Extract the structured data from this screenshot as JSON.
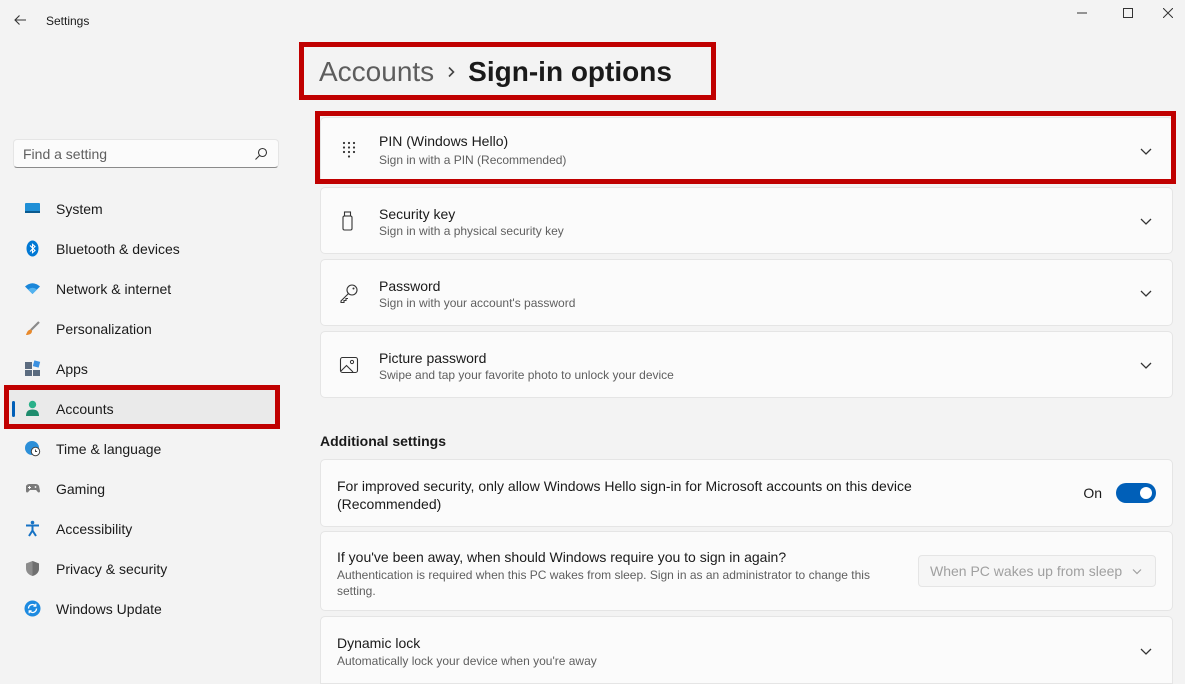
{
  "window": {
    "title": "Settings",
    "back_icon": "back-arrow-icon",
    "controls": [
      "minimize-icon",
      "maximize-icon",
      "close-icon"
    ]
  },
  "search": {
    "placeholder": "Find a setting",
    "icon": "search-icon"
  },
  "sidebar": {
    "items": [
      {
        "label": "System",
        "icon": "system-icon",
        "active": false
      },
      {
        "label": "Bluetooth & devices",
        "icon": "bluetooth-icon",
        "active": false
      },
      {
        "label": "Network & internet",
        "icon": "wifi-icon",
        "active": false
      },
      {
        "label": "Personalization",
        "icon": "brush-icon",
        "active": false
      },
      {
        "label": "Apps",
        "icon": "apps-icon",
        "active": false
      },
      {
        "label": "Accounts",
        "icon": "person-icon",
        "active": true
      },
      {
        "label": "Time & language",
        "icon": "globe-clock-icon",
        "active": false
      },
      {
        "label": "Gaming",
        "icon": "gamepad-icon",
        "active": false
      },
      {
        "label": "Accessibility",
        "icon": "accessibility-icon",
        "active": false
      },
      {
        "label": "Privacy & security",
        "icon": "shield-icon",
        "active": false
      },
      {
        "label": "Windows Update",
        "icon": "update-icon",
        "active": false
      }
    ]
  },
  "breadcrumb": {
    "parent": "Accounts",
    "separator_icon": "chevron-right-icon",
    "current": "Sign-in options"
  },
  "signin_options": [
    {
      "title": "PIN (Windows Hello)",
      "subtitle": "Sign in with a PIN (Recommended)",
      "icon": "keypad-icon"
    },
    {
      "title": "Security key",
      "subtitle": "Sign in with a physical security key",
      "icon": "usb-key-icon"
    },
    {
      "title": "Password",
      "subtitle": "Sign in with your account's password",
      "icon": "key-icon"
    },
    {
      "title": "Picture password",
      "subtitle": "Swipe and tap your favorite photo to unlock your device",
      "icon": "picture-icon"
    }
  ],
  "additional": {
    "heading": "Additional settings",
    "hello_only": {
      "text": "For improved security, only allow Windows Hello sign-in for Microsoft accounts on this device (Recommended)",
      "toggle_label": "On",
      "toggle_on": true
    },
    "require_signin": {
      "title": "If you've been away, when should Windows require you to sign in again?",
      "subtitle": "Authentication is required when this PC wakes from sleep. Sign in as an administrator to change this setting.",
      "dropdown_value": "When PC wakes up from sleep",
      "disabled": true
    },
    "dynamic_lock": {
      "title": "Dynamic lock",
      "subtitle": "Automatically lock your device when you're away"
    }
  },
  "colors": {
    "accent": "#005fb8",
    "highlight": "#c00000",
    "background": "#f3f3f3",
    "card": "#fbfbfb"
  }
}
